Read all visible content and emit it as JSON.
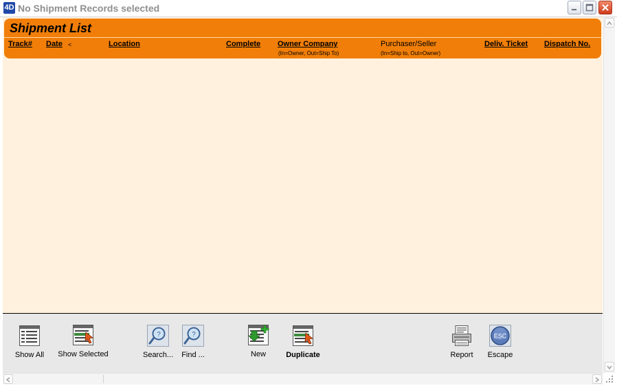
{
  "window": {
    "app_icon_text": "4D",
    "title": "No Shipment Records selected"
  },
  "list": {
    "title": "Shipment List",
    "columns": [
      {
        "label": "Track#"
      },
      {
        "label": "Date",
        "sort_indicator": "<"
      },
      {
        "label": "Location"
      },
      {
        "label": "Complete"
      },
      {
        "label": "Owner Company",
        "sub": "(In=Owner, Out=Ship To)"
      },
      {
        "label": "Purchaser/Seller",
        "sub": "(In=Ship to, Out=Owner)"
      },
      {
        "label": "Deliv. Ticket"
      },
      {
        "label": "Dispatch No."
      }
    ]
  },
  "toolbar": {
    "show_all": "Show All",
    "show_selected": "Show Selected",
    "search": "Search...",
    "find": "Find ...",
    "new": "New",
    "duplicate": "Duplicate",
    "report": "Report",
    "escape": "Escape",
    "escape_icon_text": "ESC"
  },
  "colors": {
    "header_orange": "#f07e08",
    "list_background": "#fff1de",
    "toolbar_background": "#e8e8e8"
  }
}
